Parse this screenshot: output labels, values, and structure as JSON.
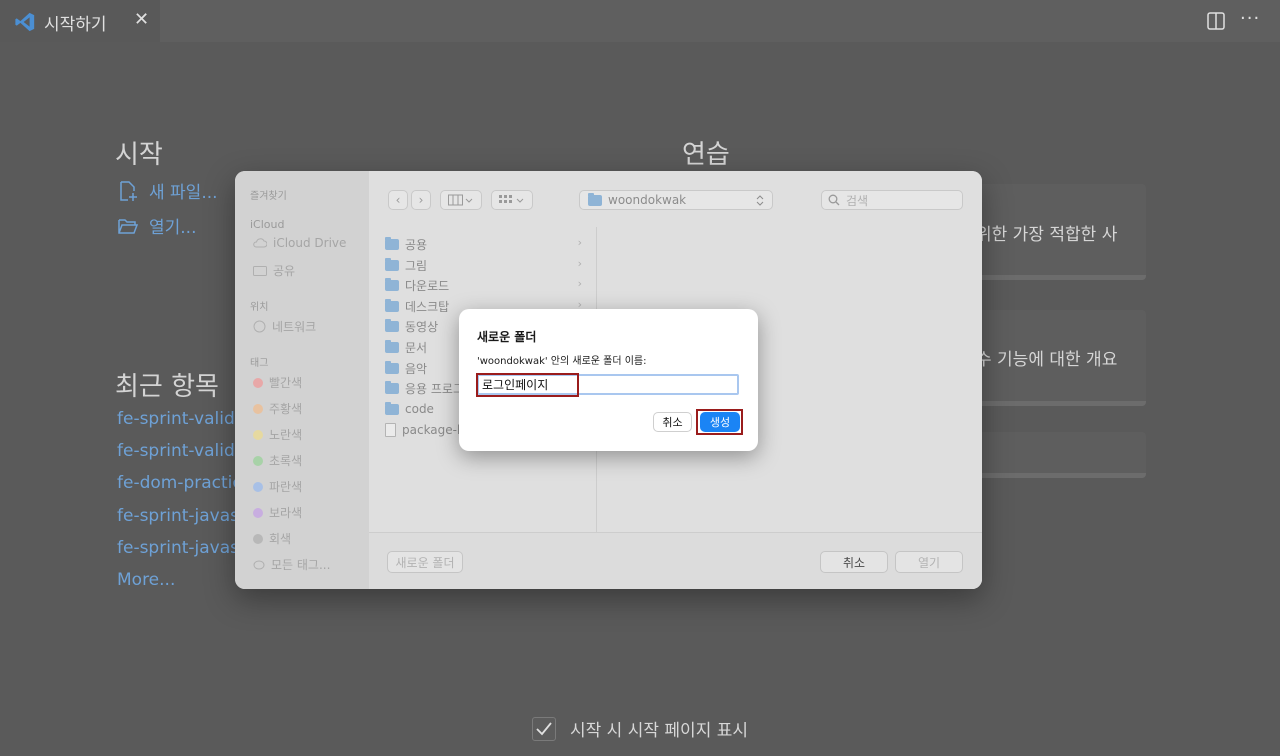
{
  "tab": {
    "title": "시작하기",
    "close": "✕"
  },
  "header": {
    "more": "···"
  },
  "welcome": {
    "start_title": "시작",
    "new_file": "새 파일...",
    "open": "열기...",
    "recent_title": "최근 항목",
    "recent": [
      "fe-sprint-valida",
      "fe-sprint-valida",
      "fe-dom-practic",
      "fe-sprint-javas",
      "fe-sprint-javas"
    ],
    "more": "More...",
    "walkthrough_title": "연습",
    "walkthroughs": [
      "위한 가장 적합한 사",
      "수 기능에 대한 개요"
    ],
    "show_startup": "시작 시 시작 페이지 표시"
  },
  "finder": {
    "sidebar": {
      "favorites": "즐겨찾기",
      "icloud": "iCloud",
      "icloud_drive": "iCloud Drive",
      "shared": "공유",
      "locations": "위치",
      "network": "네트워크",
      "tags_title": "태그",
      "tags": [
        {
          "name": "빨간색",
          "color": "#e8a8a8"
        },
        {
          "name": "주황색",
          "color": "#e8c2a0"
        },
        {
          "name": "노란색",
          "color": "#e6d9a0"
        },
        {
          "name": "초록색",
          "color": "#a8d2a8"
        },
        {
          "name": "파란색",
          "color": "#a8c0e6"
        },
        {
          "name": "보라색",
          "color": "#c8aee0"
        },
        {
          "name": "회색",
          "color": "#b8b8b8"
        }
      ],
      "all_tags": "모든 태그..."
    },
    "location": "woondokwak",
    "search_placeholder": "검색",
    "items": [
      {
        "name": "공용",
        "kind": "folder",
        "chevron": true
      },
      {
        "name": "그림",
        "kind": "folder",
        "chevron": true
      },
      {
        "name": "다운로드",
        "kind": "folder",
        "chevron": true
      },
      {
        "name": "데스크탑",
        "kind": "folder",
        "chevron": true
      },
      {
        "name": "동영상",
        "kind": "folder",
        "chevron": false
      },
      {
        "name": "문서",
        "kind": "folder",
        "chevron": false
      },
      {
        "name": "음악",
        "kind": "folder",
        "chevron": false
      },
      {
        "name": "응용 프로그",
        "kind": "folder",
        "chevron": false
      },
      {
        "name": "code",
        "kind": "folder",
        "chevron": false
      },
      {
        "name": "package-l",
        "kind": "file",
        "chevron": false
      }
    ],
    "new_folder": "새로운 폴더",
    "cancel": "취소",
    "open": "열기"
  },
  "dialog": {
    "title": "새로운 폴더",
    "description": "'woondokwak' 안의 새로운 폴더 이름:",
    "value": "로그인페이지",
    "cancel": "취소",
    "create": "생성"
  }
}
